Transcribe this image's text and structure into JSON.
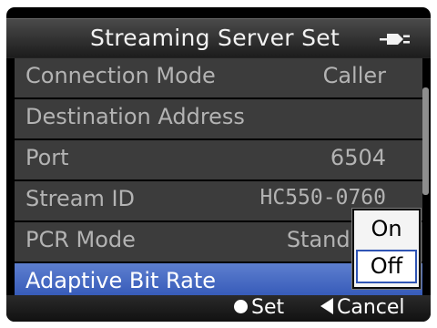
{
  "header": {
    "title": "Streaming Server Set",
    "status_icon": "power-plug-icon"
  },
  "menu": {
    "items": [
      {
        "label": "Connection Mode",
        "value": "Caller"
      },
      {
        "label": "Destination Address",
        "value": ""
      },
      {
        "label": "Port",
        "value": "6504"
      },
      {
        "label": "Stream ID",
        "value": "HC550-0760"
      },
      {
        "label": "PCR Mode",
        "value": "Standard"
      },
      {
        "label": "Adaptive Bit Rate",
        "value": "Off"
      }
    ],
    "selected_index": 5
  },
  "dropdown": {
    "options": [
      "On",
      "Off"
    ],
    "selected": "Off"
  },
  "footer": {
    "set_label": "Set",
    "cancel_label": "Cancel"
  },
  "colors": {
    "highlight": "#2f54b4",
    "row_bg": "#3c3c3c",
    "text_dim": "#b3b3b3"
  }
}
